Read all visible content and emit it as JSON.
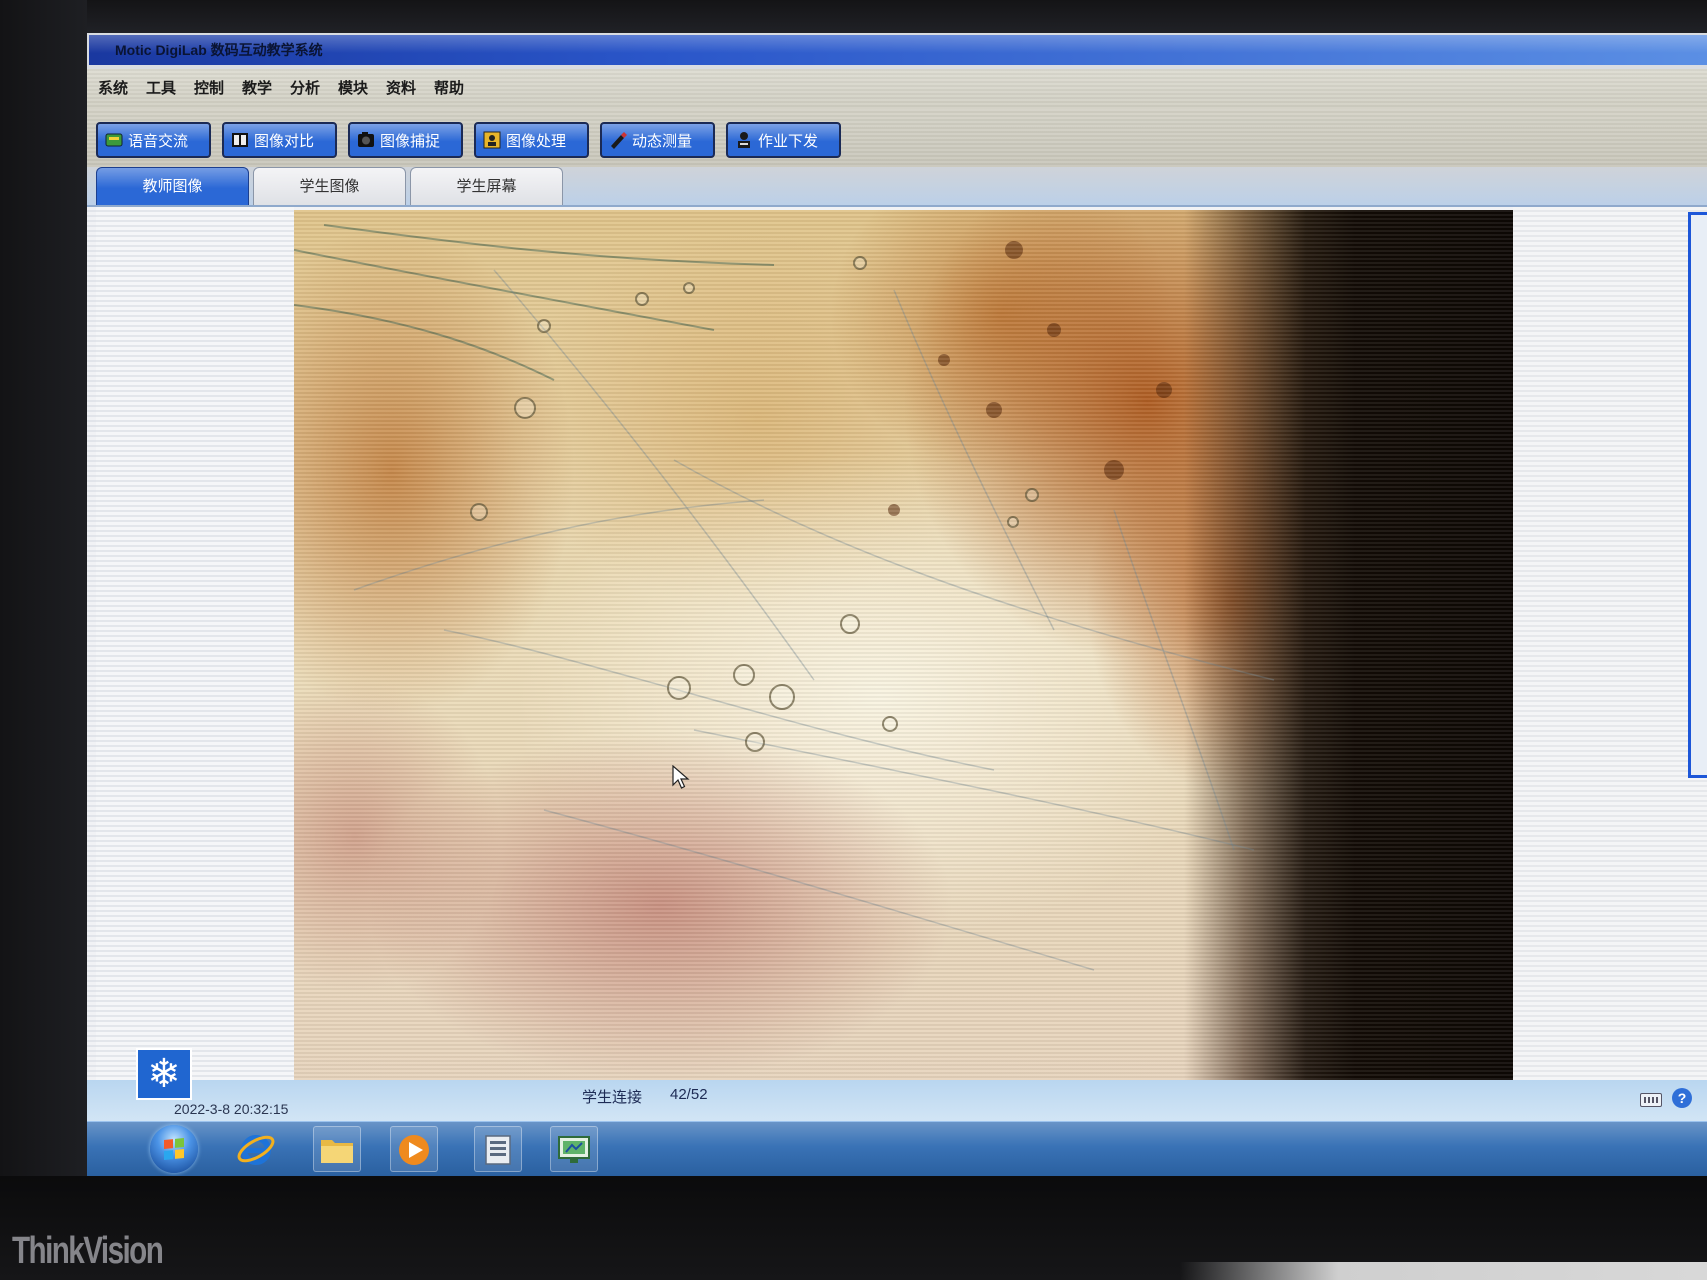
{
  "window": {
    "title": "Motic DigiLab 数码互动教学系统"
  },
  "menu": {
    "items": [
      "系统",
      "工具",
      "控制",
      "教学",
      "分析",
      "模块",
      "资料",
      "帮助"
    ]
  },
  "toolbar": {
    "buttons": [
      {
        "label": "语音交流",
        "icon": "chat-icon"
      },
      {
        "label": "图像对比",
        "icon": "compare-icon"
      },
      {
        "label": "图像捕捉",
        "icon": "capture-icon"
      },
      {
        "label": "图像处理",
        "icon": "image-process-icon"
      },
      {
        "label": "动态测量",
        "icon": "measure-icon"
      },
      {
        "label": "作业下发",
        "icon": "assignment-icon"
      }
    ]
  },
  "tabs": {
    "items": [
      {
        "label": "教师图像",
        "active": true
      },
      {
        "label": "学生图像",
        "active": false
      },
      {
        "label": "学生屏幕",
        "active": false
      }
    ]
  },
  "pointer": {
    "icon": "mouse-cursor-icon"
  },
  "status": {
    "logo_icon": "snowflake-icon",
    "connection_label": "学生连接",
    "connection_count": "42/52",
    "datetime": "2022-3-8 20:32:15"
  },
  "tray": {
    "icons": [
      "keyboard-icon",
      "help-icon"
    ],
    "help_glyph": "?"
  },
  "taskbar": {
    "apps": [
      "windows-start-icon",
      "internet-explorer-icon",
      "folder-icon",
      "media-player-icon",
      "document-app-icon",
      "microscope-app-icon"
    ]
  },
  "monitor": {
    "brand": "ThinkVision"
  },
  "colors": {
    "title_bar": "#2a56c9",
    "button": "#2b68d6",
    "active_tab": "#2b68d6",
    "status_bar": "#b9d6f0",
    "taskbar": "#2f6bb2"
  }
}
